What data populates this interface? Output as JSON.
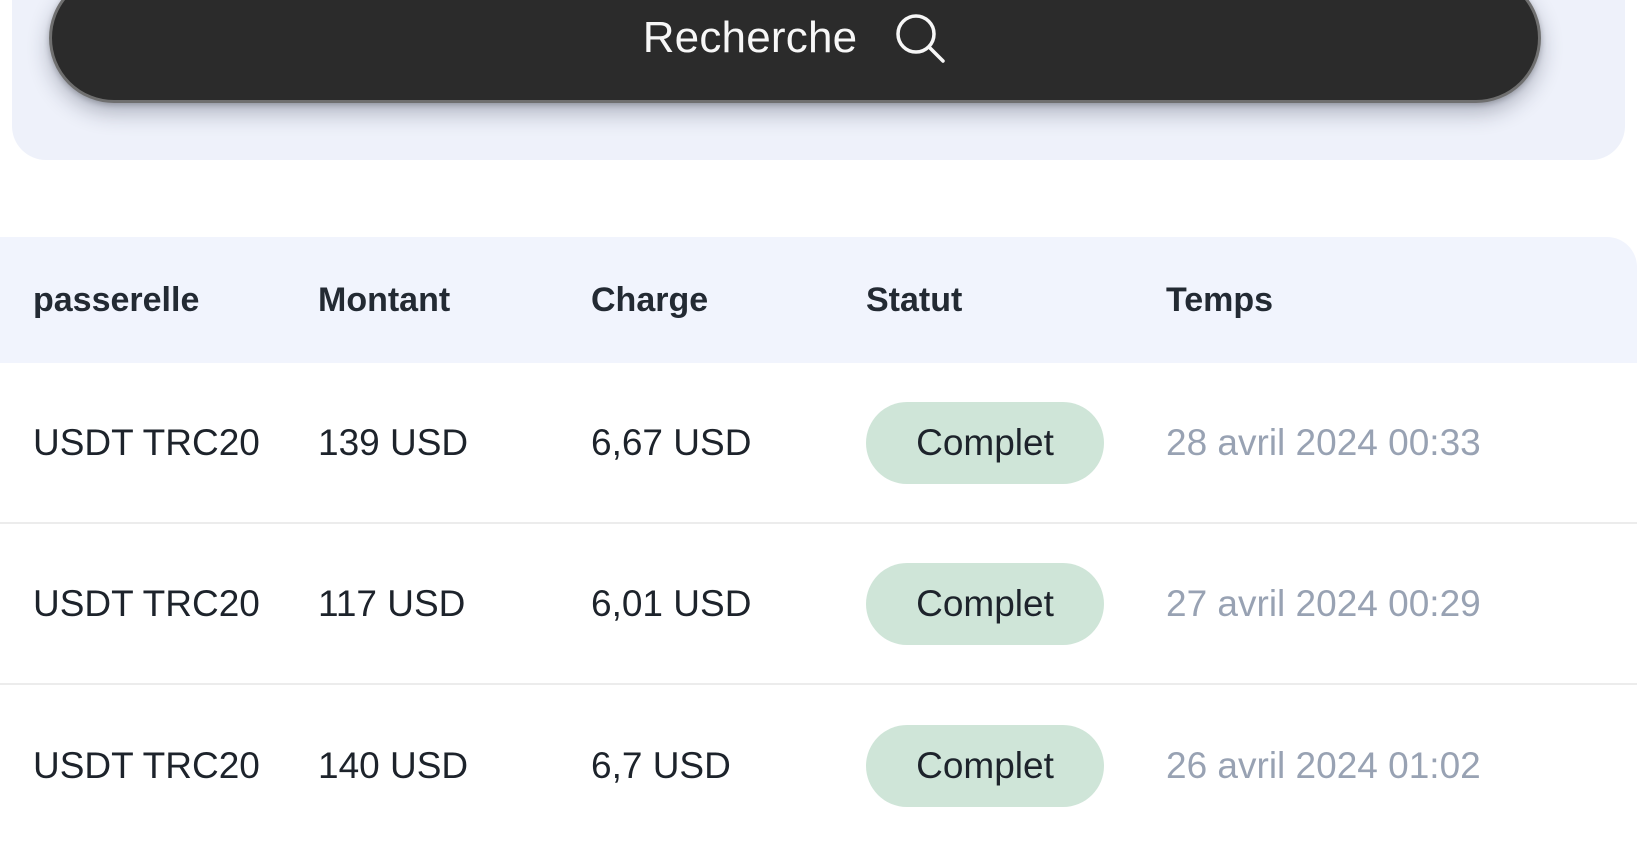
{
  "search": {
    "label": "Recherche",
    "icon": "search-icon",
    "value": "",
    "placeholder": "Recherche"
  },
  "table": {
    "columns": [
      {
        "key": "gateway",
        "label": "passerelle"
      },
      {
        "key": "amount",
        "label": "Montant"
      },
      {
        "key": "charge",
        "label": "Charge"
      },
      {
        "key": "status",
        "label": "Statut"
      },
      {
        "key": "time",
        "label": "Temps"
      }
    ],
    "rows": [
      {
        "gateway": "USDT TRC20",
        "amount": "139 USD",
        "charge": "6,67 USD",
        "status": "Complet",
        "time": "28 avril 2024 00:33"
      },
      {
        "gateway": "USDT TRC20",
        "amount": "117 USD",
        "charge": "6,01 USD",
        "status": "Complet",
        "time": "27 avril 2024 00:29"
      },
      {
        "gateway": "USDT TRC20",
        "amount": "140 USD",
        "charge": "6,7 USD",
        "status": "Complet",
        "time": "26 avril 2024 01:02"
      }
    ]
  },
  "colors": {
    "search_bar_background": "#2b2b2b",
    "search_panel_background": "#eef1fa",
    "header_background": "#f1f4fd",
    "status_badge_background": "#cfe5d8",
    "time_text": "#98a2b3",
    "row_divider": "#ececec"
  }
}
